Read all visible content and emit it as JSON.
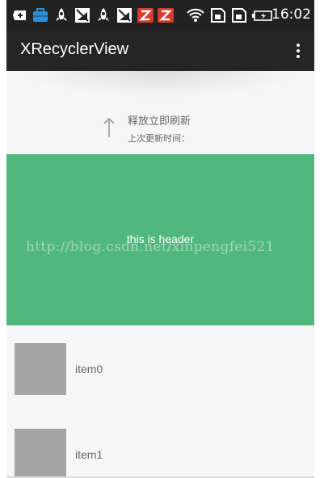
{
  "status_bar": {
    "time": "16:02",
    "icons": [
      "notification-plus-icon",
      "toolbox-icon",
      "rocket-icon",
      "no-signal-icon",
      "rocket-icon",
      "no-signal-icon",
      "z-app-icon",
      "z-app-icon",
      "wifi-icon",
      "sim-icon",
      "sim-icon",
      "battery-icon"
    ],
    "colors": {
      "background": "#222222",
      "toolbox": "#2d8fd6",
      "z_app": "#d63b2b"
    }
  },
  "toolbar": {
    "title": "XRecyclerView",
    "overflow_icon": "overflow-menu-icon",
    "background": "#252525"
  },
  "refresh_header": {
    "status": "释放立即刷新",
    "last_update_label": "上次更新时间：",
    "arrow_icon": "arrow-up-icon"
  },
  "header": {
    "text": "this is header",
    "background": "#50b87c"
  },
  "watermark": "http://blog.csdn.net/xinpengfei521",
  "items": [
    {
      "label": "item0"
    },
    {
      "label": "item1"
    }
  ]
}
